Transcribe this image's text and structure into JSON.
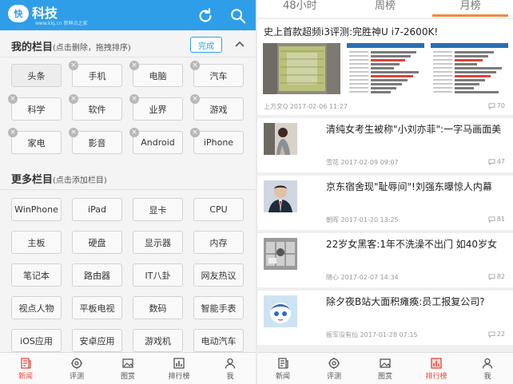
{
  "left": {
    "logo": {
      "badge": "快",
      "text": "科技",
      "sub": "www.kkj.cn  新鲜点之家"
    },
    "header_icons": [
      "refresh-icon",
      "search-icon"
    ],
    "my_section": {
      "title": "我的栏目",
      "hint": "(点击删除，拖拽排序)",
      "done_label": "完成"
    },
    "my_channels": [
      "头条",
      "手机",
      "电脑",
      "汽车",
      "科学",
      "软件",
      "业界",
      "游戏",
      "家电",
      "影音",
      "Android",
      "iPhone"
    ],
    "more_section": {
      "title": "更多栏目",
      "hint": "(点击添加栏目)"
    },
    "more_channels": [
      "WinPhone",
      "iPad",
      "显卡",
      "CPU",
      "主板",
      "硬盘",
      "显示器",
      "内存",
      "笔记本",
      "路由器",
      "IT八卦",
      "网友热议",
      "视点人物",
      "平板电视",
      "数码",
      "智能手表",
      "iOS应用",
      "安卓应用",
      "游戏机",
      "电动汽车"
    ],
    "bottom_nav": [
      {
        "label": "新闻",
        "icon": "news-icon",
        "active": true
      },
      {
        "label": "评测",
        "icon": "review-icon",
        "active": false
      },
      {
        "label": "图赏",
        "icon": "gallery-icon",
        "active": false
      },
      {
        "label": "排行榜",
        "icon": "ranking-icon",
        "active": false
      },
      {
        "label": "我",
        "icon": "user-icon",
        "active": false
      }
    ]
  },
  "right": {
    "tabs": [
      {
        "label": "48小时",
        "active": false
      },
      {
        "label": "周榜",
        "active": false
      },
      {
        "label": "月榜",
        "active": true
      }
    ],
    "articles": [
      {
        "title": "史上首款超频i3评测:完胜神U i7-2600K!",
        "author": "上方文Q",
        "time": "2017-02-06 11:27",
        "comments": "70"
      },
      {
        "title": "清纯女考生被称\"小刘亦菲\":一字马画面美",
        "author": "雪花",
        "time": "2017-02-09 09:07",
        "comments": "47"
      },
      {
        "title": "京东宿舍现\"耻辱间\"!刘强东曝惊人内幕",
        "author": "朝晖",
        "time": "2017-01-20 13:25",
        "comments": "81"
      },
      {
        "title": "22岁女黑客:1年不洗澡不出门 如40岁女",
        "author": "随心",
        "time": "2017-02-07 14:34",
        "comments": "82"
      },
      {
        "title": "除夕夜B站大面积瘫痪:员工报复公司?",
        "author": "振军没有仙",
        "time": "2017-01-28 07:15",
        "comments": "22"
      }
    ],
    "bottom_nav": [
      {
        "label": "新闻",
        "icon": "news-icon",
        "active": false
      },
      {
        "label": "评测",
        "icon": "review-icon",
        "active": false
      },
      {
        "label": "图赏",
        "icon": "gallery-icon",
        "active": false
      },
      {
        "label": "排行榜",
        "icon": "ranking-icon",
        "active": true
      },
      {
        "label": "我",
        "icon": "user-icon",
        "active": false
      }
    ]
  },
  "colors": {
    "brand_blue": "#2f9ee8",
    "active_red": "#e8453c",
    "tab_orange": "#f08a41"
  }
}
